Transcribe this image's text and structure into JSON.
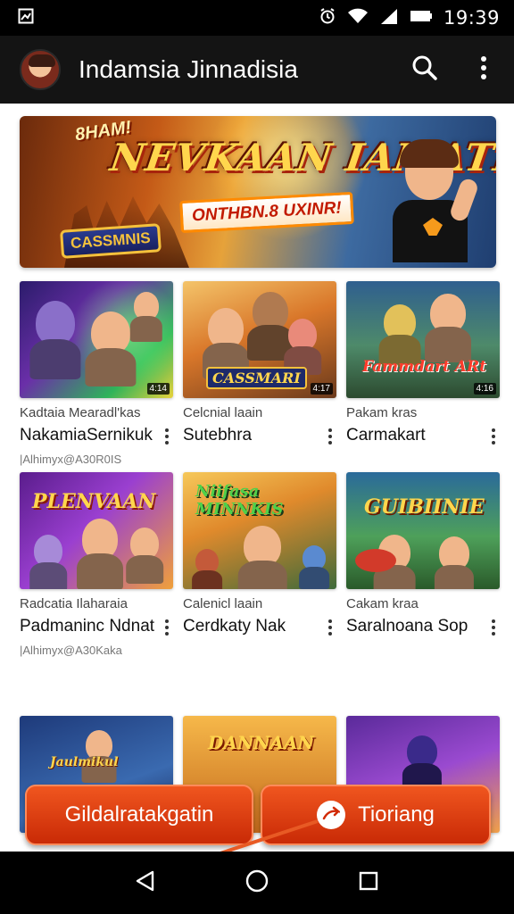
{
  "status_bar": {
    "time": "19:39"
  },
  "app_bar": {
    "title": "Indamsia Jinnadisia"
  },
  "banner": {
    "kicker": "8HAM!",
    "title": "NEVKAAN IAMATI!",
    "subtitle": "ONTHBN.8 UXINR!",
    "badge": "CASSMNIS"
  },
  "videos": [
    {
      "channel": "Kadtaia Mearadl'kas",
      "title": "NakamiaSernikuk",
      "views": "|Alhimyx@A30R0IS",
      "thumb_text": "",
      "duration": "4:14"
    },
    {
      "channel": "Celcnial laain",
      "title": "Sutebhra",
      "views": "",
      "thumb_text": "CASSMARI",
      "duration": "4:17"
    },
    {
      "channel": "Pakam kras",
      "title": "Carmakart",
      "views": "",
      "thumb_text": "Fammdart ARt",
      "duration": "4:16"
    },
    {
      "channel": "Radcatia Ilaharaia",
      "title": "Padmaninc Ndnat",
      "views": "|Alhimyx@A30Kaka",
      "thumb_text": "PLENVAAN",
      "duration": ""
    },
    {
      "channel": "Calenicl laain",
      "title": "Cerdkaty Nak",
      "views": "",
      "thumb_text": "Niifasa MINNKIS",
      "duration": ""
    },
    {
      "channel": "Cakam kraa",
      "title": "Saralnoana Sop",
      "views": "",
      "thumb_text": "GUIBIINIE",
      "duration": ""
    },
    {
      "channel": "",
      "title": "",
      "views": "",
      "thumb_text": "Jaulmikul",
      "duration": ""
    },
    {
      "channel": "",
      "title": "",
      "views": "",
      "thumb_text": "DANNAAN",
      "duration": ""
    },
    {
      "channel": "",
      "title": "",
      "views": "",
      "thumb_text": "",
      "duration": ""
    }
  ],
  "actions": {
    "left_label": "Gildalratakgatin",
    "right_label": "Tioriang"
  },
  "colors": {
    "accent": "#e0401a",
    "appbar": "#141414"
  }
}
